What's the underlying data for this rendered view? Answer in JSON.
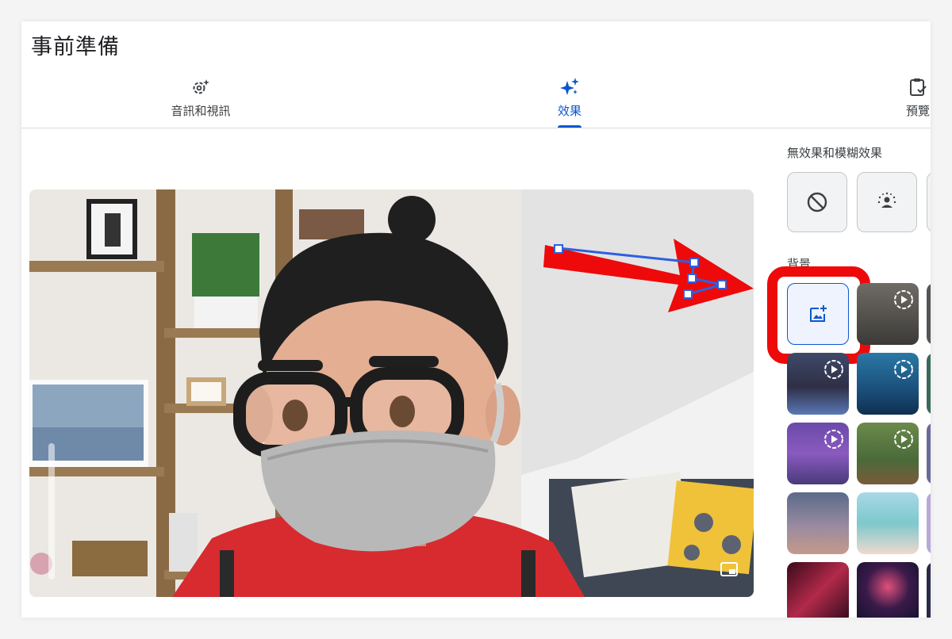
{
  "page": {
    "title": "事前準備"
  },
  "tabs": [
    {
      "label": "音訊和視訊",
      "icon": "settings-sparkle-icon",
      "active": false
    },
    {
      "label": "效果",
      "icon": "sparkle-icon",
      "active": true
    },
    {
      "label": "預覽",
      "icon": "clipboard-check-icon",
      "active": false
    }
  ],
  "effects": {
    "blur_section_label": "無效果和模糊效果",
    "background_section_label": "背景",
    "blur_options": [
      {
        "name": "no-effect",
        "icon": "block-icon"
      },
      {
        "name": "blur-background",
        "icon": "person-blur-icon"
      }
    ],
    "background_upload_icon": "add-photo-icon"
  },
  "colors": {
    "accent": "#0b57d0",
    "annotation_red": "#ee0a0a"
  }
}
